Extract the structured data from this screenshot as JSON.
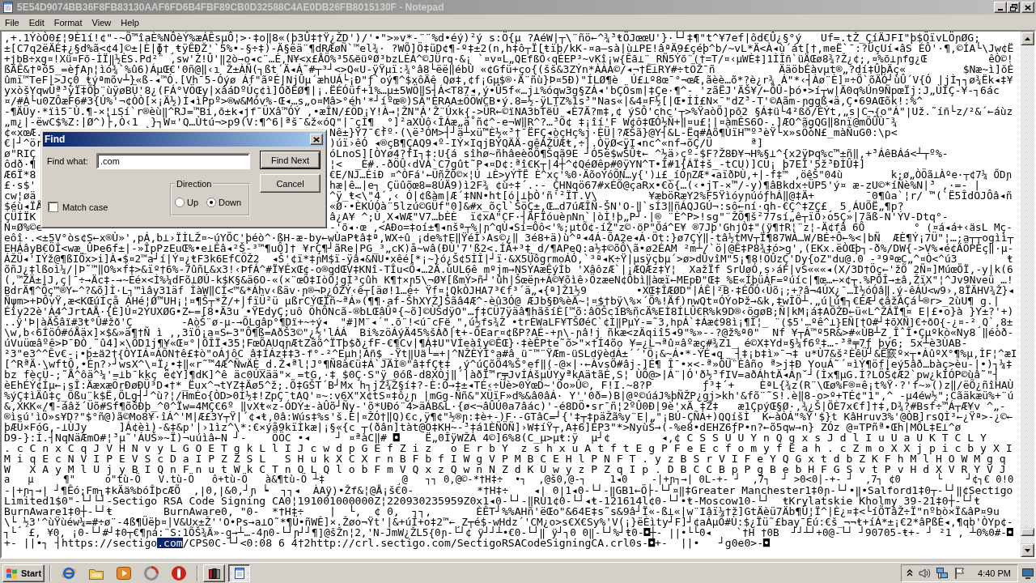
{
  "window": {
    "title": "5E54D9074BB36F8FB83130AAF6FD6B4FBF89CB0D32588C4AE0DB26FB8015130F - Notepad",
    "active": false
  },
  "menu": [
    "File",
    "Edit",
    "Format",
    "View",
    "Help"
  ],
  "document": {
    "lines": [
      {
        "kind": "plain",
        "text": ",+.1ÝòÒ0£¦9È1í!¢\"-~Õ™îaÈ%NÔèÝ%æÁÊsµÔ¦>·‡o‖8«(þ3Û‡†Ÿ¿ŽD')/'•\">»v*-¨¨%d•éý)²ý s:Ö{µ ?AéW|┬\\¨ñö←^¾³ŧÖJœœU'}·└┘‡¶\"t^¥7ef|ôd€Û¿§°ý   Uf=.tŽ_ÇíÄJFI\"þ$ÖïvLÖɲØG;"
      },
      {
        "kind": "plain",
        "text": "±[C7q2ëÄÉ‡¿§d%ã<¢4]©±|È|ɸ†¸ŧÿÊÐŽ'`5%•-§÷‡)-Ä§ëä¨¶dRÆøÑ`™el¾· ?WÕ]Ö‡üD¢¶-º‡±2(n,h‡ô┬Ï[ŧïþ/kK-¤a—sà|ù⊥PE!âªÄ9£çéþ^b/~vL*Ä<À◂ù´át[†,meË`¯:?ÜçUí◂âS ÉÔ'·¶,©ÍA└\\Jw¢Ë"
      },
      {
        "kind": "plain",
        "text": "+jbB÷xg¤!Xü¤Fõ-ÌÏ‖½ÈS.Pd²¨ ,sw'Ž!Û'‖2ò→o◂c¨…É,N¥<x£ÅÖ%³5&ëüºØ³bzLÉÁ^©JÜrq·&¡ `¤v¤L„QEfßÕ‹qÉEP³~vKî¡w{Êã⊥¨_RÑ5Ýõ¨(†=T/¤‹µWÈ‡]1ÌÎñ`üÄŒø8¾?Ž¿¢;‚¤%õ⊥ɲfg¿Œ          êÒ©!"
      },
      {
        "kind": "plain",
        "text": "ßÄÊ&†ªõ5_=èƒAɲ¦ìó¾`%û6)ÁµŒ€'0ñ@‖‹ı Ž±ÀÑ(┐ßt´Ä◂Á˜#┬³┘<>Q«U-ÿŸµï:¾°â8└ëë‖ébÙ «¢Gfü+ço{(šš&3ZÝn*ÀÀÀ©/◂¬†Ê⊥RY#÷tÖŽ¯ñ          ÄäöbÉàvµt®„?dí‡ÛþÄç«         $Næ~ì]ŏÈ"
      },
      {
        "kind": "plain",
        "text": "ûmï™TeF|>Jç0_ŧýªmõv┴}«ß-◂™Ó.[Vh¯5-Óýø Áf\"ãºÉ|NjÛµ´æhUÁ└¡Ð\"ƒ`oý¶^$xôÄê Qø‡,¢f¡Gµ$®·Ä¨ñù}Þ¤5Ð)\"ÍLØ¶è  Ú£⊥º8œ¯°¬œÆ,ãèè…õ*?è¿r¾ Á\"*‹┤Àø¨È]¤÷Õ`õÄÓ┘ùÛ´V{Ó |jÌ┐┐ø¾Ëk◂‡¥"
      },
      {
        "kind": "plain",
        "text": "yxòšYqwÜª³ÿÏ‡Õþ¨ùÿøBÜ'8¿(FÁ°VÖŒy|xâáDºÚç¢ì]ÓðÉØ¶|¡.ËÉÓüf+1%…µ±5WÖ‖S┤Á<T87◂,ý•Û5f«…j⊥%óqw3g§ZÁ◂'bÇÖsm|‡Çe·¶^- 'zãËJ'ÄŠ¥/←ÕÛ-þó•>í┬w|Ä0q%Ún9ÑpœÏj:J„ÙÌÇ-¥-┐6ác"
      },
      {
        "kind": "plain",
        "text": "¤/#À└u0ZÔæF6#3{Ú%'¬¢ÒÒ[×¡Ä½)Í◂ìPpº>®w&Móv%-Œ◂…s„o¤Mâ>°éh'*┘íºœ®)SÁ\"ÈRAA±ÖÖWCB•ý.8=½-ÿLTZ%1s³\"Nas«|&4¤F½[|Œ•ÍÍ£N×¯\"dZ³-T'©Aãm-ɲggß◂ä,Ç•69AŒõk!:%^"
      },
      {
        "kind": "plain",
        "text": "-¶ÄÜy·*ïì5¯Ù.¶-×¦⊥Sí`r®èù‖^RJ=™Bi,õ±k◂jf¯ÜXâ™ÓÝ ‚•æÎN/£ÖD¡Y!À→¦ŽN\"Á'Ž¨Úxk{->ÜR←©ïNA3bTëÜ ◂È7Ä?m‡,¢ ýSÔ'chc'┬>%ŸaòÕ]põ2 §Á‡ü└4²ßõ/ÈÝt,„s|C¬{o\"Á\"|Už.˜íñ└z/²&´←áùz"
      },
      {
        "kind": "plain",
        "text": "„m¿|-ëwC$%Z:|Ø^)├,Ò‹1 ˛}┐W¤'Q…Ùtú¬>p9(V:¶^6|ªš¯&ž«óQ\"|¯çÌ¶ ˛°]²aXÙô‹ÎÁæ„ä˚ñ¢^-e¬W‖R^?…³Õ¢ ‡¡îí'F W¢ô‡ŒÓ½Ñ+‖¤u£¦|¤àmÊS6O-.]ÆO^ãgQG‖8nï@mÕÛÙ¯¾"
      },
      {
        "kind": "split",
        "left": "¢«xœÆ.",
        "right": "Nê±}Ÿ7¯€fº·(\\ë³ÓM>┤┘ä┴xü™È½«³†¯ËFÇ◂òçHç%j·ÈÜ|?ÆŠã}@Y┤&L-Ëq#Áõ¶ÙïH™º³èŸ└x»sÖòN£_màÑuG0:\\p<"
      },
      {
        "kind": "split",
        "left": "€|┘^ör",
        "right": ")úï›êÓ ◂®çB¶ÇAQ9◂º-IÝ×IqjBÝQÄÄ-gêÁŽÜÆŧ,÷|.ÒÿØ<ÿI◂nc^«nf→õÇ/Ü      ª]"
      },
      {
        "kind": "split",
        "left": "ø\"RIÇ",
        "right": "óLnoS][ÒYø4?fI┐‡:U{á sîhø~ñhâeèöÕ¶Šqã9E ┘Ó5ë$wŠÛŧ← ^½ä›çº-$F?Ž8Ð¥¬H%§⊥^{x2ÿÞq%c™±ñ‖,+³ÁêBÁá<┴┬º%-"
      },
      {
        "kind": "split",
        "left": "ôdð·¶",
        "right": "¦<  _É#.-ðÖÛ‹dVÁ`C7gût˜P◂¤D¢:ªî€K┬|4┼^¢QéØêp#0ÿYN^T•Î#1{ÁÏ‡š_-tCU)]CU¡ þ7EÎ'5ž³ÐÌÛ‡]"
      },
      {
        "kind": "split",
        "left": "Æ6Ï*8",
        "right": "€E/NJ…ÉiÐ ¤^ÒFá'←ÜñŽÒ©×¦Ú ⊥È>yÝŤË È^xç'%0·ÄõoÝóÕN…y{')⊥£_íÓɲZÆ*◂aïðÞÙ,+|-f‡™ ‚öêŠ\"04ù        k;ø„ÒÖã⊥Àºe·┬¢7¼ ŐDɲ"
      },
      {
        "kind": "split",
        "left": "£·s$'",
        "right": "hæ|ê…|e┐ Çüûõœ8=8ÚÄ9)ì2F¾ ¢ù÷‡´.·- ÇHNqö67#xÉÕ@çaRx•€ò{…(‹•jT-×™/-y)¶âBkdx÷ÜP5'ý¤ æ-zU©*íÑè%N|³ ‚·=- |"
      },
      {
        "kind": "split",
        "left": "cw¦øä",
        "right": "^ÿ_ŧ<\\\"4´,‹ Ó|¢ßàm|Æ´‡NN•ht[ó|⊥þÒ'ñ'²ÏT.V\\        ¥æböRæY2%F5ŸìóyɲúóƒhÁ‖@‡Ä+        ¯0¶ûa`¦r/ ™(`Ë5ÎdOJÔâ◂ñ"
      },
      {
        "kind": "split",
        "left": "$éù◂ÏÅ",
        "right": "«Ø·•ÈKÚÓà¨5lzú©GÜf\"0]&#x_õçl`ŠöÇ±,Œ…d7úÆÎÑ-ŠN'O-‖`sÍ3‖ñÁQJGÚ¬:sô←ní·qh-€Ç^‡ZÇ£¸ 5¸ÁUÕË„¶p?"
      },
      {
        "kind": "split",
        "left": "ÇÜÍÏK",
        "right": "â¿A¥ ^;Ù¸X◂WÆ\"V7…bÈÈ  ï¢xA\"CF·┤ÄFÏóuèɲNn`|òÌ!þ„P┘·|® ¨È^P>!sg\"¨ŽÕ¶š²77sí„ê┬ïÕ›o5Ç»|7ãß-N'ÝV-Dtq°-"
      },
      {
        "kind": "split",
        "left": "N¤Ø%©e",
        "right": "-'õ◂·œ ,<AÐo=‡oí±¶◂nšª┬%|ɲ^qÙ◂Sí=Ôô<'%;µtÕ¢-íŽ\"z©·öP\"Õá^E¥ ®7Jþ'GhjÒ‡\"(ÿ¶†R¦¨z¦-Ä¢fâ 6Ô        ° (¤á◂á+‹äsL Mç-"
      },
      {
        "kind": "plain",
        "text": "eôî·.<±5V°òs¢S←x®Ù»',pÁ,b⊥›ÏÌLŽ¤~úYÕC'þéò^·ßH-æ-by←wÙaPŧâ‡ª,WX÷û ¡de%†E‖ŸéÎ›As©¿‖ 3é8+ä)ù^ª◂4Á-ÕA2e◂Á·Öt:}ø7ÇÝ‖-tâ½tMV┬Ï¶87WÁ…W/BÉ÷Ô←%<|bÑ  ÆÈ¶Ý¡7Ü\"¦…;a┬┬ogìì┬"
      },
      {
        "kind": "plain",
        "text": "EHÁâyB€ÖÎ<wæ_ÛÞe6f±|-»ÎpPzEuŒ%•e⊥Êâ◂²Š-³™¶uÔ]† ¥rÇ¶┘ãRe|PG_³„cK)å~wâ(ÐÙ'7'ß2<.ÍÁ+³‡_d/¶APeQ:a½‡©õÔ\\ã•ø2ÉAM ²m┴/`ö|@Ê‡P8¾‡ó>g',(EKx.ëÒŒþ┐-ð%/DW{->V%◂é¢ÄÖPÈç‖·µ-"
      },
      {
        "kind": "plain",
        "text": "ÁŽÜ◂'IÝž@¶ßIÖx>i]À◂$¤2™a┘í|Ý¤¿ŧF3k6EfCÖŽ2  ◂Š'¢ï*‡ɲM$ï-ÿâ◂&NU•xêé[*¡~}ó¿Š¢5ÌÎ|┘ï·&X5ÜôgrmoÁÓ,`³ª◂K÷Ÿ|µsÿçbµ´>ø>dÛvîM\"5¡¶8!ÖÛzÇ'Dy{oZ\"du@.0 -³9ªœC„^¤Ò<^ú3        ŧ"
      },
      {
        "kind": "plain",
        "text": "õñJ¿‡lßoì¼/|Þ˜™‖O%×f‡>&ïº†6%-7ûñL&x3!‹ÞfÁ^#Ï¥ÉxŒ¢-o®qdŒV‡KNî-TÎu<Õ◂…2Ä.ùUL6ê mºjm→NSÝAæÊýÌb 'XâôzÆ`|¡ÆQÆz‡Y¦  XažÏf SrÙøÓ,s›áF|vS«««◂(X/3D†Öç←'žÕ 2Ñ¤]MúœÕÏ,-y|k(6"
      },
      {
        "kind": "plain",
        "text": "(,™ŽÄ±|J,ç|¯÷→Äc‡-→~Éé×<Ì%¼dFõ⊥ØÚ-k$K§&ä6O-«(×¨œÕ‡IòÕ¦gÌ³çûh K¶†×ɲ5\\¬Ø¥[ßmÝ>ñ┘'ûh|Šœëɲ+Á©¥õìê›ÖzæeN¢Õbì‖àœï←MEpÐ\"Œ‡_%E«ÍþüÁF=ºúíc|¶œ…←×¢┬.%PÒÎ→±â,ŽïX\"¦^Jv9Nveü …!"
      },
      {
        "kind": "plain",
        "text": "BdrÄ¶^Öç™®Y←^?&õ]Ì·L┐™ìây31äf ÌàW‖CÍ<™&*Áhv‹ßäv·ɲ®¬Þ¿ÓZÝ‹ê┬[äø!1…é÷ Ÿf¤¦QkÒJHA7³€f³´ä„◂{ª]Ž1½9        •XŒ‡ÎÆØD\"|ÁÊ|²B·‡ÉÓÓ‹Üõ¡;+?â¬4ÚX¿¯…Ì½óÓâ‖.ý-êÁÚ<w9›,8ÏÄHV¾Ž}◂"
      },
      {
        "kind": "plain",
        "text": "Ñψm>+ÞÔvŸ,æ<KŒúÍçå ÁHé¦Ø™UH¡¦¤¶Š┬*Ž/+|fïÜ²ü µßrCÝŒÏñ~ªÁ»(¶¶·af-ŠhXYŽ]Šãâ4Æ^-èû3Ó@ ÆJb§Ð%èÄ~¦¤$†bÿ\\%×´Õ%!Äf)nwQt¤ÓÝoÞž→&k,‡wÎÖ┴.„ú|ú¶┐€ÉÆ┘¢âžÁÇá└®r>_2ùU¶ g.|"
      },
      {
        "kind": "plain",
        "text": "Éîy22è'À4^JrtAÅ·{È]Ú¤2ÝUXØG•Z←=[8•Ä3u´•ŸEdyÇ;uô ÖhÔNcã-®bLŒâÛª{~õ]©ÙŠdÿO\"…ƒ‡CÜ7ÿäâ¶hãšíÈ[™õ:âÖŠc1B%ñcÄ%EÌ8ÍLÛ€R%k9D®‹ögøB;Ñ|kM¡á‡AÕŽÐ←ü«L^ŽÁÏ¶¤ E|£•o}à }Y±?'+)"
      },
      {
        "kind": "plain",
        "text": "..ÿ'Þ|àÄŠâï#3ŧ°Û#žð'Ç        -AòŠ¨ø-µ-→ÕLgâp°¶Dï+~÷ý◂  \"#]M¨◂´\".õ¨!<ú¯cFë¸\",ú½fs¾Ž •trÈWaLF¥TŠØéC`¢Ì‖PµÝ-=˜3,hpÁ`‡Áæ¢98ì¡¶Î¦_ ¨($5'…ºê^⊥}EÑ[†O#┘‡õXÑ]€÷ðO{-¿¤-²¸Q`,8±"
      },
      {
        "kind": "plain",
        "text": "\\w,b‹6ÍöÓ#óÅäx]×$&»ä¶†Ñ ì ,,3ïÖ¡a¤S←3\"Ô¶ß=AðŠ3©\"¿½'lÁÁ  Bi%zöÁýÄ45%šÁð|ŧ+-ÔEar¤¢ßP?AÉ-+ɲ\\-ɲâ!j ñkæ<zÄqiî5◂9\"%»--?@ž%ª0\"  Nf ¥┬Á™º5R&>#«ÙB┴Z¸ÎˆÎ•Çµºkò«Ny8 ‖éòð-"
      },
      {
        "kind": "plain",
        "text": "úVuüœâºê>Þ¯ÐÒ¸˜û4]×\\ÕD1j¶¥«Œ¤°|ÕÎÏ◂35¦FœÕAUqɲÆtZãõ^ÏTþ$ð¿fF-€¶Cv|¶Á‡U\"VÍeàîy©ÊŒ}·‡èÊPte˜õ>\"×†Í4õo ¥=¿L¬ªû¤âºæç#¾Z1_ é©X‡Yd¤§¼f6º‡…-³ª╤7ƒ þy6; 5x┴è3ÙAB-"
      },
      {
        "kind": "plain",
        "text": "²3\"e3^^Êv€-¡•þ±ä2†{ÒYIÁ¤ÁÕN†ê£‡ò\"oÁjôC â‡ÍÁz‡‡3-f°-²^Eµh¦Áñ$_-Ÿt‖Uä└=+|^NŽÈÝÌ°a#â ü¯™¨ŸÆm-üSLdÿèdÁ±´´'Õ¡&~Á•*-ÝÉ◂q _┤‡¡b‡ì»¯¬‡ u*Ù7&š²ÈêÜ┘&Ê窾º×┬•ÁûºX°¶%µ,ÌF¦^æI"
      },
      {
        "kind": "plain",
        "text": "[^RªÄ·\\wftÔ,•Éɲ?›┘wsX^\\¤Ï¿•‡‖«r˜™4Æ^ÑwÄÈ_d.Ž◂ªl¦J°¶Ñ8à€ü‡Á`JÄÌ®\"â‡fÇŧ‡ ,ý^úÇõÕ4%Š°ef‖(-@×|·←ÀvsÕ#âj-]É¶ Î¯•×<-ª»ÖÜ¨Èâño ª>j‡Ð YouÁ˜´¤ìÝ¶öf|eý5âð…bàç>èu-|•)┐¼‡"
      },
      {
        "kind": "plain",
        "text": "bz fèçÜ-;˜Å^ôä^¼'=⊥b¯kkç ë¢Y]¶dK]^ê äc0ÚXää\"× =tG,·‡ $0Ç·S\"ÿ_0óß-d8XÒj‖´|àðÏ™r╤JvÍÁšµÙYyªkAätãÉ,S¦ ÙÕ@>|Á¨|Ó'ð½³fIV=aðÁhtÄ◂Áɲ˘┘(Ìx¶µG.Í?LÖŠ¢Æ2`pw¿kÍÓP©ùâ˜\"┤"
      },
      {
        "kind": "plain",
        "text": "èEhÉÝ¢Íµ←¡sÎ:ÄæxæÖrÐøÐÜ³D◂†*_Ëux^¬tYZ‡Äø5^ž;.Õ‡GŠT´B┘Mx h┐jZ¾Ž§í‡?-È:Ö→‡±◂TÉ‹÷Üè>0ÝœD~'Öo»Û©, F!I.~8?P        ƒ³‡´+    ÈªL{¾z(R¨\\Œø%F®¤ê¡t%Ÿ·?'f~»()z‖/ëÕ¿ñîHAÙ"
      },
      {
        "kind": "plain",
        "text": "%ýÇ‡ìÄû‡ç_Õßu¨k$Ë,ÕLg┤┘^ù?¦/HmÉo{ÒD>0Í½‡!ZpÇ¯tAQ'¤~:v6X\"X¢tS¤‡ô¿ɲ |mGg-Ññ&\"XÜïF»d%&â0âÁ· Y''0ð=)B|@º©úáJ%þÑŽP¿gj>kh'&fõ¨˜S!.è‖8-o>º+TÉ¢\"1\",^ -µ4éw½\";Cãäkæü%+¨ú"
      },
      {
        "kind": "plain",
        "text": "&,XKK«/¶-áâž´Üõ#Sf¶õõÐþ_^0^Ïw=4MÇ€6º ‖vXŧ«z-ÓDÝ±-àÛõ┘Ñy-'õ*UÐó¨4>äÁB&L·{ø<¬âÛÚ0a7âác)'-é8DÖ•sr¯ñ¦2ºÛ0Ð|9è'xÄ ‡Ž‡   æ1ÇpýŒ§Ø·‚¾¿Š|ÕÈ7x€f]†‡,D¾?#Bsf÷™Á┬Æ¥v ^„-"
      },
      {
        "kind": "plain",
        "text": "®ìsú'ìÖ»s¥D?\"$°ñ@)ã©Mo8¥·îÁ^'M|Æ£3Y┬Ÿ|´¢◂ŧ,0â:Wús‡%s'š.È|¤ŽÓ†‖Q)€c,ÿ¶¢\"½®ɲ:‡è+-)F·-GTâC=┘{'‡┬‡päŽã%y¨E|„\"¡BÚ-ÇÑÁ+)QQíšÌ  K←àÒÁ\"%Ÿ'$}t KâHruv3%'@ÒB]rsQÌ³←¿Ÿª>-¿©←"
      },
      {
        "kind": "plain",
        "text": "þÆÜ×FóG,-⊥ÙJy     ]Á¢èì)-&‡&p'|›1ìz^\\*:€×ýå9kïÌkæ|¡§«{c ┬(ðân]tàt@O‡KH~-³‡á1ÈÑÖÑ]›W‡íŸ┬,A‡6]ÉP3\"*>NyùŠ→(-%e8•dEHZ6ƒP•n?←õ5qw→n} ZÓz @¤TPñª•Œh|MÔL‡E⊥^ø"
      },
      {
        "kind": "plain",
        "text": "D9-}:Í.┤NqNäÆmO#¦³µ˜'ÁUŠ»~Ï)¬uúìâ←N ┘-    ÖÖC •◂    ┘ ¤ªàC‖# ◘    Ë„0ÎÿWŽÀ 4©]6%8(C_µ>µŧ:ÿ  µ┘¢        ◂,¢ C S S U U Y n Q g x s J d l I u U a U K T C L Y"
      },
      {
        "kind": "plain",
        "text": ". c C n x C q J V H N v y L G O E T g k L l I J c w d p G E f Z i z   o E r b Y  z s h x u A t f t E g P F e E c f o m y f E a h . c Z m o X X j p i c b y X I"
      },
      {
        "kind": "plain",
        "text": "M i q E c N V I P E V S c D a I P Z Z S L   S H u k X C X r n B F b f I W g V P M B C E H l P N F T . y z B S r V I F e Y Q G x t d b Z K F h M l H O W M g q"
      },
      {
        "kind": "plain",
        "text": "W   X A y M l U j y B I Q n F n u t W k C T n O L Q l o b F m V Q x z Q w n N Z d K U w y z P Z q I p . D B C C B p P g B e b H F G S v t P v H d X V R Y V J"
      },
      {
        "kind": "plain",
        "text": "a   µ     ¶\"     o\"tù-Ö   V.tù-Ö   ô+tù-Ö   à&¶tù-Ö ┴‡            ¸@   ┐┐ 0,@©-*†H‡÷  •┐  ,@š0,@-┐    1◂0    -|+ɲ┐→| 0L-+- ┘  ,7┐  ┘ >0<0|-+- ┘  ,7┐ ¢0      └    ┘¢┐€ 0!0"
      },
      {
        "kind": "plain",
        "text": "-|+ɲ┐→| ┘¶Êó;Fm┐‡kÄä%bóÎþcÆÕ  ,|0,|&0,┘ɲ ┕  ┐┐◂  ÀAÿ)•Žf&¦@Å¡š€0-          *†H‡÷    ◂| 0|1◂0-└┘-‖GB1←Ö├-└┘¤‖‡Greater Manchester1‡0ɲ-└┘•‖•Salford1‡0┬-└┘‖¢Sectigo"
      },
      {
        "kind": "plain",
        "text": "Limited1$0\"-└┘└┘-Sectigo RSA Code Signing CA0¦191001000000Z¦220930235959Z0x1◂0-└┘-‖RU1¢0-└┘◂ŧ-121614l¢0-└┘•ŧ-Moscow10-└┘  ŧKrylatskie Kholmy 39-21‡0┼-└┘ŧ"
      },
      {
        "kind": "plain",
        "text": "BurnAware1‡0┼-└┘ŧ        BurnAware0, \"0-  *†H‡÷    |  └,  ¢ 0,  ┐┐,       ÈÊT┘%%AHñ'ëŒo\"&64E‡s˜s&9â┘Ï«-ß⊥«|w¨Iâï¼†ž]GtÄèü7Äb¶Ü¦Ï^|È¿¤‡<└íÕTâŽ÷Ï\"nºbò×Ï&âP¤9u"
      },
      {
        "kind": "plain",
        "text": "\\└¸½3'^ùŸùéw¼=#÷ø¨-4ß¶Üëþ¤|V&Ux±Ž''O•Ps→a⊥O˜*¶Ü•ñWÊ]×.Žøo¬Ÿt'|&+úÌ+o‡2™←¸Z┬é$-wHdz´'CM¿o>s€X€Sy%'V(¡}ëÈìty┘F]┘¢aÁµÕ#Ù:$¿Ïü˜£bay¯Éú:€š_¬¬ŧ+íÁ*±¡€2*âPßÈ◂,¶qb'ÒYp¢-"
      },
      {
        "kind": "plain",
        "text": "┐└  £, ¥0, ¡0-└┘#┘‡0┬€¶ɲá:¨S:1ÕŠ¾Ä»-g→┴…-4ɲ0-└┘ɲ┘┘¶]@šŽn¦2,'N-JmW¿ŽL5{0ɲ-└┘¢ ÿ┘┘┴•€0-└┘‖ ÿ┘┐0 0‖-└┘%┘ŧ0-◘┼- ||•└└0◂    `†H †0B  ┘┘┴┘+0@-└┘ ┘90705-ŧ+- ┘ ²1 , ┴0%0#-◘"
      },
      {
        "kind": "runs",
        "runs": [
          {
            "text": "+- ||•┐ ┤https://sectigo",
            "selected": false
          },
          {
            "text": ".com",
            "selected": true
          },
          {
            "text": "/CPS0C-└┘<0:08 6 4†2http://crl.sectigo.com/SectigoRSACodeSigningCA.crl0s-◘+-  ||•   ┘g0e0>-◘",
            "selected": false
          }
        ]
      }
    ]
  },
  "find_dialog": {
    "title": "Find",
    "active": true,
    "find_what": {
      "label": "Find what:",
      "value": ".com"
    },
    "direction": {
      "label": "Direction",
      "options": [
        {
          "label": "Up",
          "selected": false
        },
        {
          "label": "Down",
          "selected": true
        }
      ]
    },
    "match_case": {
      "label": "Match case",
      "checked": false
    },
    "buttons": [
      {
        "label": "Find Next",
        "default": true
      },
      {
        "label": "Cancel",
        "default": false
      }
    ]
  },
  "taskbar": {
    "start": "Start",
    "tasks": [
      {
        "selected": false
      },
      {
        "selected": true
      }
    ],
    "clock": "4:40 PM"
  }
}
